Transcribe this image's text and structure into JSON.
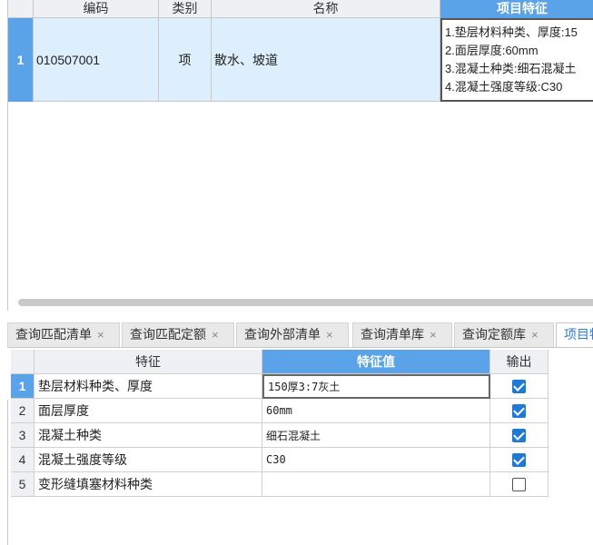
{
  "top_grid": {
    "columns": [
      "编码",
      "类别",
      "名称",
      "项目特征"
    ],
    "rows": [
      {
        "num": "1",
        "code": "010507001",
        "category": "项",
        "name": "散水、坡道",
        "features": [
          "1.垫层材料种类、厚度:15",
          "2.面层厚度:60mm",
          "3.混凝土种类:细石混凝土",
          "4.混凝土强度等级:C30"
        ]
      }
    ]
  },
  "tabs": [
    {
      "label": "查询匹配清单",
      "close": "×"
    },
    {
      "label": "查询匹配定额",
      "close": "×"
    },
    {
      "label": "查询外部清单",
      "close": "×"
    },
    {
      "label": "查询清单库",
      "close": "×"
    },
    {
      "label": "查询定额库",
      "close": "×"
    },
    {
      "label": "项目特",
      "close": ""
    }
  ],
  "bottom_grid": {
    "columns": [
      "特征",
      "特征值",
      "输出"
    ],
    "rows": [
      {
        "num": "1",
        "feature": "垫层材料种类、厚度",
        "value": "150厚3:7灰土",
        "output": true
      },
      {
        "num": "2",
        "feature": "面层厚度",
        "value": "60mm",
        "output": true
      },
      {
        "num": "3",
        "feature": "混凝土种类",
        "value": "细石混凝土",
        "output": true
      },
      {
        "num": "4",
        "feature": "混凝土强度等级",
        "value": "C30",
        "output": true
      },
      {
        "num": "5",
        "feature": "变形缝填塞材料种类",
        "value": "",
        "output": false
      }
    ]
  },
  "colors": {
    "selected_header": "#5aa3e8",
    "selected_row": "#ddeefc",
    "checkbox_on": "#1e7ad6",
    "active_tab_text": "#2d7cd6"
  }
}
